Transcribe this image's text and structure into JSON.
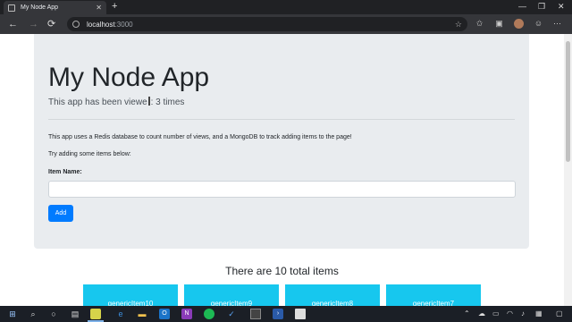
{
  "browser": {
    "tab_title": "My Node App",
    "new_tab": "+",
    "url_host": "localhost",
    "url_port": ":3000",
    "back": "←",
    "forward": "→",
    "reload": "⟳",
    "win_min": "—",
    "win_restore": "❐",
    "win_close": "✕"
  },
  "page": {
    "heading": "My Node App",
    "views_prefix": "This app has been viewe",
    "views_suffix": ": 3 times",
    "description": "This app uses a Redis database to count number of views, and a MongoDB to track adding items to the page!",
    "prompt": "Try adding some items below:",
    "item_label": "Item Name:",
    "item_value": "",
    "add_button": "Add",
    "total_text": "There are 10 total items",
    "items": [
      "genericItem10",
      "genericItem9",
      "genericItem8",
      "genericItem7"
    ]
  },
  "colors": {
    "jumbotron": "#e9ecef",
    "button": "#007bff",
    "card": "#17c7ee"
  },
  "icons": {
    "taskbar": [
      "windows-icon",
      "search-icon",
      "cortana-icon",
      "task-view-icon",
      "app-icon",
      "edge-icon",
      "file-explorer-icon",
      "outlook-icon",
      "onenote-icon",
      "spotify-icon",
      "todo-icon",
      "terminal-icon",
      "powershell-icon",
      "files-icon"
    ]
  }
}
